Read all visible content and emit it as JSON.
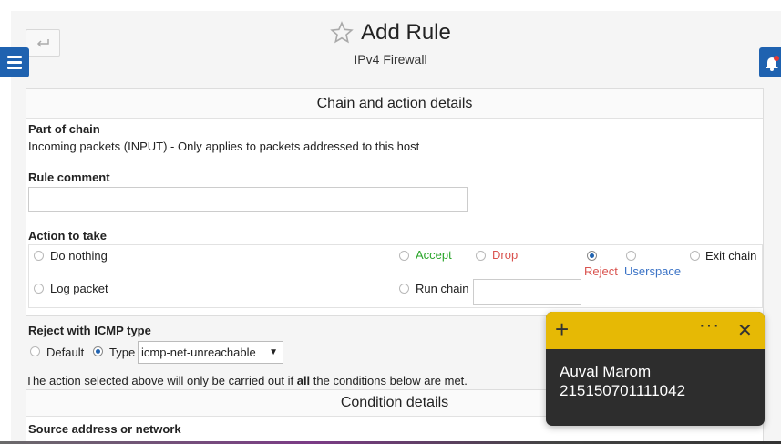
{
  "header": {
    "title": "Add Rule",
    "subtitle": "IPv4 Firewall"
  },
  "chain_panel": {
    "heading": "Chain and action details",
    "part_of_chain_label": "Part of chain",
    "part_of_chain_value": "Incoming packets (INPUT) - Only applies to packets addressed to this host",
    "rule_comment_label": "Rule comment",
    "rule_comment_value": "",
    "action_label": "Action to take",
    "actions": {
      "do_nothing": "Do nothing",
      "accept": "Accept",
      "drop": "Drop",
      "reject": "Reject",
      "userspace": "Userspace",
      "exit_chain": "Exit chain",
      "log_packet": "Log packet",
      "run_chain": "Run chain"
    },
    "action_colors": {
      "accept": "#2aa52a",
      "drop": "#d9534f",
      "reject": "#d9534f",
      "userspace": "#3b73c6"
    },
    "selected_action": "Reject",
    "run_chain_value": ""
  },
  "icmp": {
    "label": "Reject with ICMP type",
    "default_label": "Default",
    "type_label": "Type",
    "selected_option": "Type",
    "type_value": "icmp-net-unreachable"
  },
  "condition_note": {
    "before": "The action selected above will only be carried out if ",
    "bold": "all",
    "after": " the conditions below are met."
  },
  "condition_panel": {
    "heading": "Condition details",
    "source_label": "Source address or network"
  },
  "sticky_note": {
    "line1": "Auval Marom",
    "line2": "215150701111042",
    "color": "#e6b905"
  },
  "icons": {
    "back": "back-arrow-icon",
    "menu": "hamburger-icon",
    "bell": "bell-icon",
    "star": "star-icon"
  }
}
